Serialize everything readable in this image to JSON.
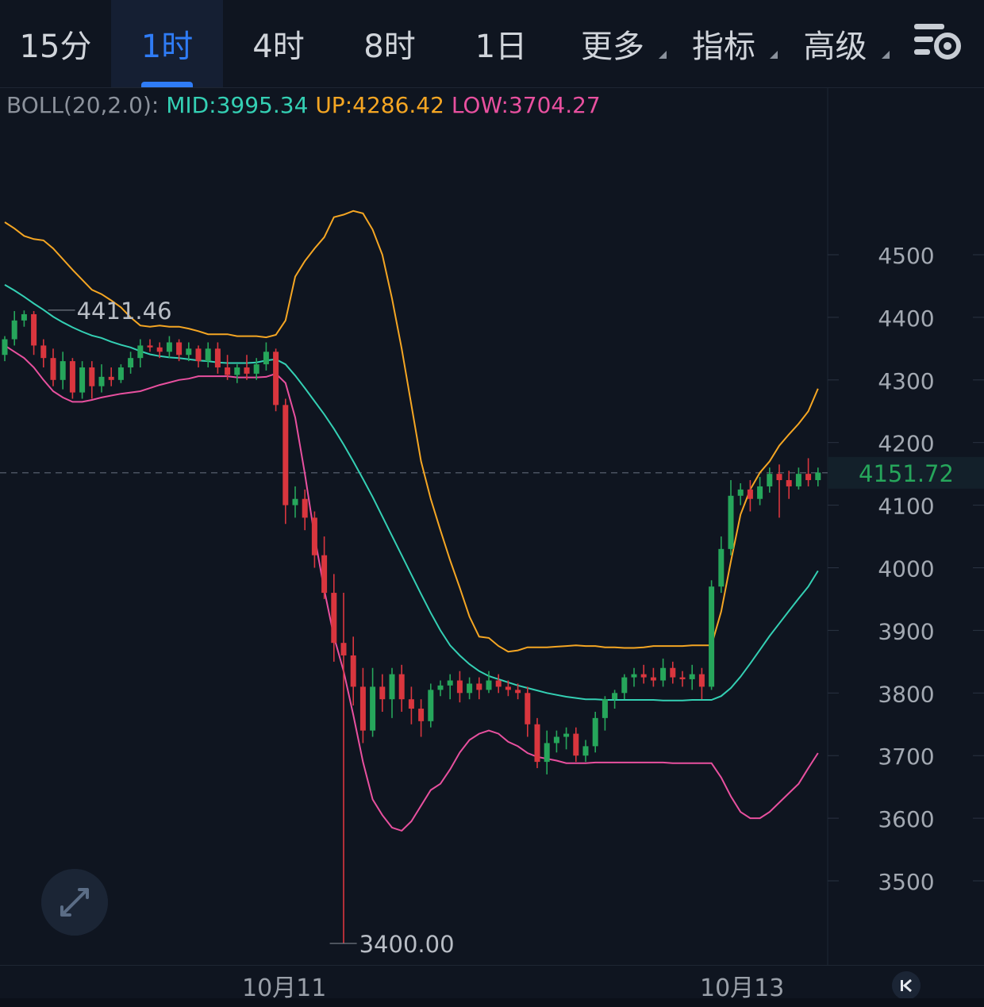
{
  "tabs": {
    "t15m": "15分",
    "t1h": "1时",
    "t4h": "4时",
    "t8h": "8时",
    "t1d": "1日",
    "more": "更多",
    "indicators": "指标",
    "advanced": "高级"
  },
  "icons": {
    "settings": "chart-settings-icon",
    "expand": "expand-icon",
    "back": "skip-to-start-icon"
  },
  "legend": {
    "name": "BOLL(20,2.0):",
    "mid": "MID:3995.34",
    "up": "UP:4286.42",
    "low": "LOW:3704.27"
  },
  "colors": {
    "background": "#0f1520",
    "active_tab": "#2f7cf6",
    "up_candle": "#26a65b",
    "down_candle": "#d9363e",
    "mid": "#34d0b4",
    "upper": "#f5a623",
    "lower": "#e8509f",
    "price_tag_text": "#26a65b"
  },
  "chart_data": {
    "type": "candlestick",
    "indicator": "BOLL(20,2.0)",
    "ylim": [
      3360,
      4600
    ],
    "y_ticks": [
      4500,
      4400,
      4300,
      4200,
      4100,
      4000,
      3900,
      3800,
      3700,
      3600,
      3500
    ],
    "x_labels": [
      "10月11",
      "10月13"
    ],
    "x_label_index": [
      26,
      74
    ],
    "last_price": 4151.72,
    "last_price_label": "4151.72",
    "high_marker": {
      "value": 4411.46,
      "label": "4411.46",
      "index": 3
    },
    "low_marker": {
      "value": 3400.0,
      "label": "3400.00",
      "index": 33
    },
    "candles": [
      [
        4340,
        4370,
        4330,
        4365
      ],
      [
        4365,
        4410,
        4355,
        4395
      ],
      [
        4395,
        4411,
        4385,
        4405
      ],
      [
        4405,
        4410,
        4340,
        4355
      ],
      [
        4355,
        4365,
        4320,
        4335
      ],
      [
        4335,
        4350,
        4290,
        4300
      ],
      [
        4300,
        4345,
        4285,
        4330
      ],
      [
        4330,
        4335,
        4270,
        4280
      ],
      [
        4280,
        4330,
        4270,
        4320
      ],
      [
        4320,
        4330,
        4270,
        4290
      ],
      [
        4290,
        4325,
        4280,
        4305
      ],
      [
        4305,
        4320,
        4290,
        4300
      ],
      [
        4300,
        4325,
        4295,
        4320
      ],
      [
        4320,
        4345,
        4310,
        4335
      ],
      [
        4335,
        4365,
        4320,
        4355
      ],
      [
        4355,
        4365,
        4345,
        4352
      ],
      [
        4352,
        4360,
        4335,
        4345
      ],
      [
        4345,
        4370,
        4335,
        4360
      ],
      [
        4360,
        4365,
        4330,
        4340
      ],
      [
        4340,
        4360,
        4330,
        4350
      ],
      [
        4350,
        4355,
        4320,
        4330
      ],
      [
        4330,
        4360,
        4320,
        4350
      ],
      [
        4350,
        4360,
        4310,
        4320
      ],
      [
        4320,
        4340,
        4300,
        4308
      ],
      [
        4308,
        4325,
        4295,
        4320
      ],
      [
        4320,
        4340,
        4300,
        4310
      ],
      [
        4310,
        4335,
        4300,
        4325
      ],
      [
        4325,
        4360,
        4315,
        4345
      ],
      [
        4345,
        4350,
        4250,
        4260
      ],
      [
        4260,
        4270,
        4070,
        4100
      ],
      [
        4100,
        4130,
        4080,
        4110
      ],
      [
        4110,
        4125,
        4060,
        4080
      ],
      [
        4080,
        4090,
        4000,
        4020
      ],
      [
        4020,
        4050,
        3950,
        3960
      ],
      [
        3960,
        3990,
        3850,
        3880
      ],
      [
        3880,
        3960,
        3400,
        3860
      ],
      [
        3860,
        3890,
        3780,
        3810
      ],
      [
        3810,
        3840,
        3720,
        3740
      ],
      [
        3740,
        3840,
        3730,
        3810
      ],
      [
        3810,
        3830,
        3770,
        3790
      ],
      [
        3790,
        3840,
        3760,
        3830
      ],
      [
        3830,
        3845,
        3770,
        3790
      ],
      [
        3790,
        3810,
        3750,
        3775
      ],
      [
        3775,
        3790,
        3730,
        3755
      ],
      [
        3755,
        3815,
        3745,
        3805
      ],
      [
        3805,
        3820,
        3795,
        3812
      ],
      [
        3812,
        3830,
        3790,
        3820
      ],
      [
        3820,
        3835,
        3785,
        3800
      ],
      [
        3800,
        3825,
        3790,
        3815
      ],
      [
        3815,
        3825,
        3790,
        3805
      ],
      [
        3805,
        3835,
        3800,
        3820
      ],
      [
        3820,
        3830,
        3800,
        3810
      ],
      [
        3810,
        3820,
        3795,
        3805
      ],
      [
        3805,
        3815,
        3790,
        3800
      ],
      [
        3800,
        3810,
        3730,
        3750
      ],
      [
        3750,
        3760,
        3680,
        3690
      ],
      [
        3690,
        3740,
        3670,
        3720
      ],
      [
        3720,
        3740,
        3705,
        3730
      ],
      [
        3730,
        3745,
        3710,
        3735
      ],
      [
        3735,
        3745,
        3690,
        3700
      ],
      [
        3700,
        3725,
        3690,
        3715
      ],
      [
        3715,
        3770,
        3705,
        3760
      ],
      [
        3760,
        3795,
        3740,
        3790
      ],
      [
        3790,
        3805,
        3775,
        3800
      ],
      [
        3800,
        3830,
        3790,
        3825
      ],
      [
        3825,
        3840,
        3810,
        3830
      ],
      [
        3830,
        3845,
        3815,
        3825
      ],
      [
        3825,
        3840,
        3810,
        3820
      ],
      [
        3820,
        3855,
        3810,
        3840
      ],
      [
        3840,
        3850,
        3815,
        3825
      ],
      [
        3825,
        3835,
        3810,
        3822
      ],
      [
        3822,
        3845,
        3805,
        3830
      ],
      [
        3830,
        3840,
        3790,
        3810
      ],
      [
        3810,
        3980,
        3805,
        3970
      ],
      [
        3970,
        4050,
        3960,
        4030
      ],
      [
        4030,
        4140,
        4020,
        4115
      ],
      [
        4115,
        4135,
        4100,
        4125
      ],
      [
        4125,
        4140,
        4090,
        4110
      ],
      [
        4110,
        4145,
        4100,
        4130
      ],
      [
        4130,
        4160,
        4120,
        4150
      ],
      [
        4150,
        4165,
        4080,
        4140
      ],
      [
        4140,
        4155,
        4110,
        4130
      ],
      [
        4130,
        4160,
        4125,
        4150
      ],
      [
        4150,
        4175,
        4130,
        4140
      ],
      [
        4140,
        4160,
        4130,
        4152
      ]
    ],
    "series": [
      {
        "name": "MID",
        "values": [
          4452,
          4443,
          4433,
          4422,
          4412,
          4401,
          4392,
          4384,
          4377,
          4371,
          4367,
          4361,
          4356,
          4352,
          4346,
          4341,
          4338,
          4336,
          4335,
          4333,
          4331,
          4330,
          4328,
          4327,
          4327,
          4327,
          4328,
          4331,
          4333,
          4325,
          4307,
          4287,
          4266,
          4245,
          4222,
          4197,
          4170,
          4142,
          4113,
          4082,
          4051,
          4020,
          3989,
          3958,
          3928,
          3900,
          3876,
          3860,
          3846,
          3835,
          3827,
          3822,
          3817,
          3812,
          3808,
          3804,
          3800,
          3797,
          3794,
          3792,
          3790,
          3790,
          3789,
          3789,
          3789,
          3789,
          3789,
          3789,
          3788,
          3788,
          3788,
          3789,
          3789,
          3789,
          3795,
          3808,
          3826,
          3847,
          3869,
          3891,
          3911,
          3931,
          3951,
          3970,
          3995
        ]
      },
      {
        "name": "UP",
        "values": [
          4552,
          4542,
          4530,
          4525,
          4523,
          4510,
          4493,
          4476,
          4460,
          4444,
          4437,
          4427,
          4416,
          4400,
          4387,
          4385,
          4387,
          4385,
          4385,
          4382,
          4378,
          4373,
          4373,
          4373,
          4370,
          4370,
          4370,
          4368,
          4372,
          4395,
          4465,
          4490,
          4510,
          4528,
          4560,
          4564,
          4570,
          4566,
          4540,
          4500,
          4430,
          4350,
          4260,
          4170,
          4110,
          4060,
          4012,
          3968,
          3922,
          3890,
          3888,
          3875,
          3866,
          3868,
          3873,
          3873,
          3873,
          3874,
          3875,
          3876,
          3875,
          3875,
          3873,
          3873,
          3872,
          3872,
          3873,
          3875,
          3875,
          3875,
          3875,
          3876,
          3876,
          3876,
          3930,
          4010,
          4085,
          4125,
          4152,
          4170,
          4195,
          4213,
          4230,
          4250,
          4286
        ]
      },
      {
        "name": "LOW",
        "values": [
          4355,
          4345,
          4335,
          4320,
          4300,
          4282,
          4272,
          4265,
          4265,
          4268,
          4272,
          4275,
          4278,
          4280,
          4282,
          4287,
          4292,
          4296,
          4300,
          4302,
          4306,
          4306,
          4306,
          4306,
          4304,
          4304,
          4304,
          4305,
          4310,
          4295,
          4240,
          4150,
          4050,
          3965,
          3890,
          3835,
          3765,
          3690,
          3630,
          3605,
          3585,
          3580,
          3595,
          3620,
          3645,
          3655,
          3678,
          3705,
          3725,
          3735,
          3740,
          3735,
          3722,
          3715,
          3704,
          3698,
          3695,
          3692,
          3688,
          3688,
          3688,
          3689,
          3689,
          3689,
          3689,
          3689,
          3689,
          3689,
          3689,
          3688,
          3688,
          3688,
          3688,
          3688,
          3665,
          3635,
          3610,
          3600,
          3600,
          3610,
          3625,
          3640,
          3655,
          3680,
          3704
        ]
      }
    ]
  }
}
